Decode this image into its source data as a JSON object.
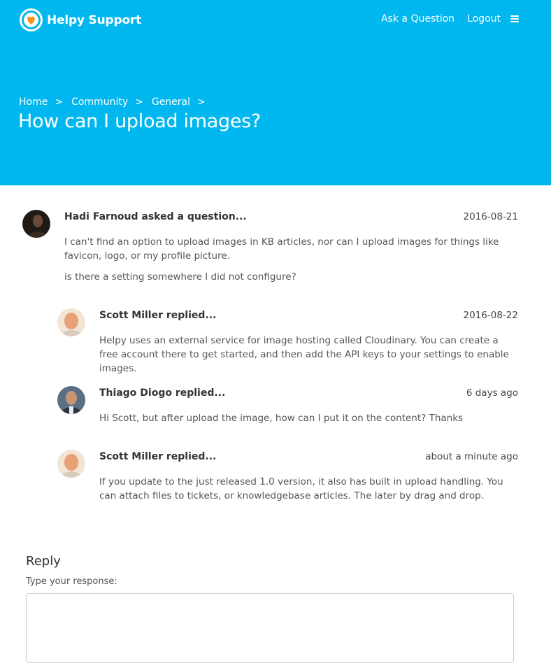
{
  "header": {
    "brand": "Helpy Support",
    "nav": {
      "ask": "Ask a Question",
      "logout": "Logout"
    },
    "breadcrumb": [
      "Home",
      "Community",
      "General"
    ],
    "breadcrumb_sep": ">",
    "title": "How can I upload images?",
    "colors": {
      "hero": "#00b7ef",
      "logo_heart": "#f7941d"
    }
  },
  "question": {
    "author": "Hadi Farnoud asked a question...",
    "date": "2016-08-21",
    "paragraphs": [
      "I can't find an option to upload images in KB articles, nor can I upload images for things like favicon, logo, or my profile picture.",
      "is there a setting somewhere I did not configure?"
    ]
  },
  "replies": [
    {
      "author": "Scott Miller replied...",
      "date": "2016-08-22",
      "text": "Helpy uses an external service for image hosting called Cloudinary. You can create a free account there to get started, and then add the API keys to your settings to enable images."
    },
    {
      "author": "Thiago Diogo replied...",
      "date": "6 days ago",
      "text": "Hi Scott, but after upload the image, how can I put it on the content? Thanks"
    },
    {
      "author": "Scott Miller replied...",
      "date": "about a minute ago",
      "text": "If you update to the just released 1.0 version, it also has built in upload handling. You can attach files to tickets, or knowledgebase articles. The later by drag and drop."
    }
  ],
  "reply_form": {
    "title": "Reply",
    "label": "Type your response:",
    "value": ""
  }
}
